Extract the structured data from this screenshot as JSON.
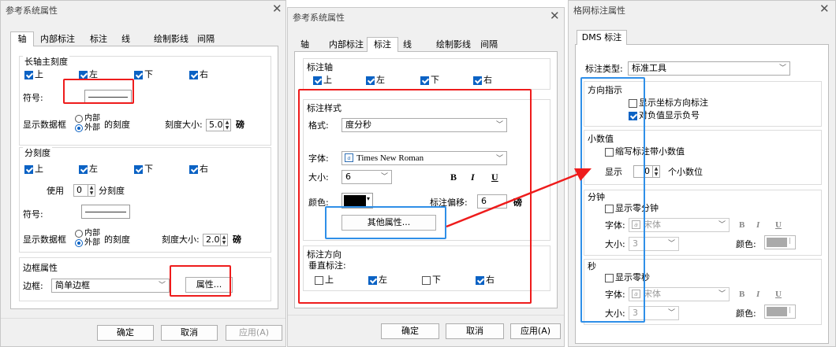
{
  "dialog1": {
    "title": "参考系统属性",
    "tabs": [
      "轴",
      "内部标注",
      "标注",
      "线",
      "绘制影线",
      "间隔"
    ],
    "major": {
      "group": "长轴主刻度",
      "checks": [
        {
          "label": "上",
          "on": true
        },
        {
          "label": "左",
          "on": true
        },
        {
          "label": "下",
          "on": true
        },
        {
          "label": "右",
          "on": true
        }
      ],
      "symbol_label": "符号:",
      "show_box": "显示数据框",
      "radio_inner": "内部",
      "radio_outer": "外部",
      "of_ticks": "的刻度",
      "size_label": "刻度大小:",
      "size_value": "5.0",
      "unit": "磅"
    },
    "minor": {
      "group": "分刻度",
      "checks": [
        {
          "label": "上",
          "on": true
        },
        {
          "label": "左",
          "on": true
        },
        {
          "label": "下",
          "on": true
        },
        {
          "label": "右",
          "on": true
        }
      ],
      "use_label": "使用",
      "use_value": "0",
      "use_suffix": "分刻度",
      "symbol_label": "符号:",
      "show_box": "显示数据框",
      "radio_inner": "内部",
      "radio_outer": "外部",
      "of_ticks": "的刻度",
      "size_label": "刻度大小:",
      "size_value": "2.0",
      "unit": "磅"
    },
    "border": {
      "group": "边框属性",
      "label": "边框:",
      "value": "简单边框",
      "props_button": "属性..."
    },
    "buttons": {
      "ok": "确定",
      "cancel": "取消",
      "apply": "应用(A)"
    }
  },
  "dialog2": {
    "title": "参考系统属性",
    "tabs": [
      "轴",
      "内部标注",
      "标注",
      "线",
      "绘制影线",
      "间隔"
    ],
    "axis_group": "标注轴",
    "axis_checks": [
      {
        "label": "上",
        "on": true
      },
      {
        "label": "左",
        "on": true
      },
      {
        "label": "下",
        "on": true
      },
      {
        "label": "右",
        "on": true
      }
    ],
    "style_group": "标注样式",
    "format_label": "格式:",
    "format_value": "度分秒",
    "font_label": "字体:",
    "font_value": "Times New Roman",
    "size_label": "大小:",
    "size_value": "6",
    "bold": "B",
    "italic": "I",
    "underline": "U",
    "color_label": "颜色:",
    "offset_label": "标注偏移:",
    "offset_value": "6",
    "offset_unit": "磅",
    "more_button": "其他属性...",
    "dir_group": "标注方向",
    "vertical_label": "垂直标注:",
    "dir_checks": [
      {
        "label": "上",
        "on": false
      },
      {
        "label": "左",
        "on": true
      },
      {
        "label": "下",
        "on": false
      },
      {
        "label": "右",
        "on": true
      }
    ],
    "buttons": {
      "ok": "确定",
      "cancel": "取消",
      "apply": "应用(A)"
    }
  },
  "dialog3": {
    "title": "格网标注属性",
    "tab": "DMS 标注",
    "type_label": "标注类型:",
    "type_value": "标准工具",
    "direction_group": "方向指示",
    "show_dir": "显示坐标方向标注",
    "neg_sign": "对负值显示负号",
    "decimal_group": "小数值",
    "abbr_decimal": "缩写标注带小数值",
    "show_label": "显示",
    "decimal_value": "0",
    "decimal_suffix": "个小数位",
    "minute_group": "分钟",
    "show_zero_min": "显示零分钟",
    "second_group": "秒",
    "show_zero_sec": "显示零秒",
    "font_label": "字体:",
    "font_value": "宋体",
    "size_label": "大小:",
    "size_value": "3",
    "color_label": "颜色:",
    "bold": "B",
    "italic": "I",
    "underline": "U"
  },
  "colors": {
    "highlight_red": "#ee1c1c",
    "highlight_blue": "#2f8fe8",
    "check_blue": "#0b62c4"
  }
}
